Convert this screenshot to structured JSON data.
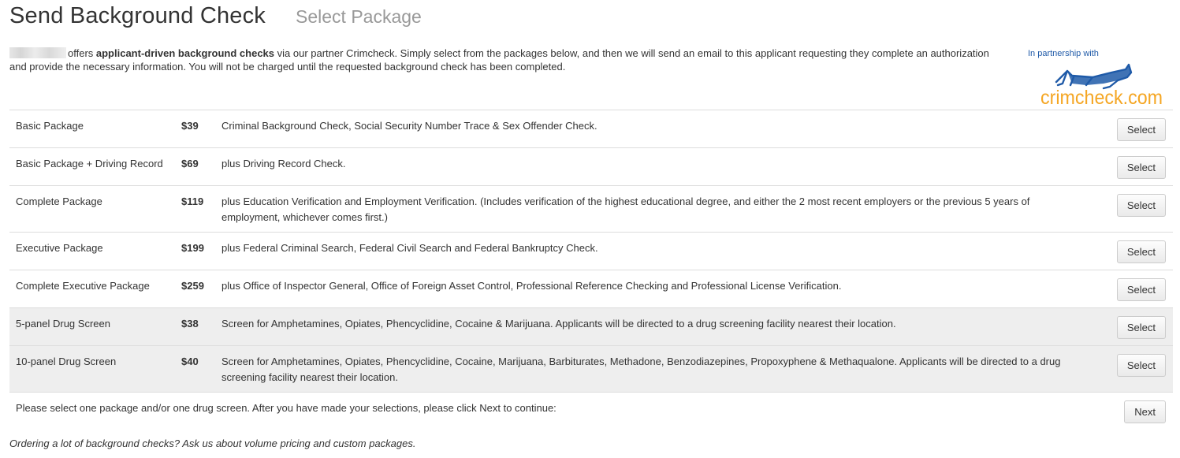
{
  "header": {
    "title": "Send Background Check",
    "subtitle": "Select Package"
  },
  "intro": {
    "pre": "offers ",
    "bold": "applicant-driven background checks",
    "post": " via our partner Crimcheck. Simply select from the packages below, and then we will send an email to this applicant requesting they complete an authorization and provide the necessary information. You will not be charged until the requested background check has been completed."
  },
  "partner": {
    "label": "In partnership with",
    "logo_text": "crimcheck.com",
    "logo_color": "#f5a623",
    "label_color": "#1f5aa8"
  },
  "packages": [
    {
      "name": "Basic Package",
      "price": "$39",
      "description": "Criminal Background Check, Social Security Number Trace & Sex Offender Check.",
      "button": "Select"
    },
    {
      "name": "Basic Package + Driving Record",
      "price": "$69",
      "description": "plus Driving Record Check.",
      "button": "Select"
    },
    {
      "name": "Complete Package",
      "price": "$119",
      "description": "plus Education Verification and Employment Verification. (Includes verification of the highest educational degree, and either the 2 most recent employers or the previous 5 years of employment, whichever comes first.)",
      "button": "Select"
    },
    {
      "name": "Executive Package",
      "price": "$199",
      "description": "plus Federal Criminal Search, Federal Civil Search and Federal Bankruptcy Check.",
      "button": "Select"
    },
    {
      "name": "Complete Executive Package",
      "price": "$259",
      "description": "plus Office of Inspector General, Office of Foreign Asset Control, Professional Reference Checking and Professional License Verification.",
      "button": "Select"
    }
  ],
  "drug_screens": [
    {
      "name": "5-panel Drug Screen",
      "price": "$38",
      "description": "Screen for Amphetamines, Opiates, Phencyclidine, Cocaine & Marijuana. Applicants will be directed to a drug screening facility nearest their location.",
      "button": "Select"
    },
    {
      "name": "10-panel Drug Screen",
      "price": "$40",
      "description": "Screen for Amphetamines, Opiates, Phencyclidine, Cocaine, Marijuana, Barbiturates, Methadone, Benzodiazepines, Propoxyphene & Methaqualone. Applicants will be directed to a drug screening facility nearest their location.",
      "button": "Select"
    }
  ],
  "instructions": {
    "text": "Please select one package and/or one drug screen. After you have made your selections, please click Next to continue:",
    "next_label": "Next"
  },
  "footer": {
    "note": "Ordering a lot of background checks? Ask us about volume pricing and custom packages."
  },
  "colors": {
    "text": "#333333",
    "muted": "#999999",
    "row_shade": "#eeeeee",
    "border": "#dddddd"
  }
}
